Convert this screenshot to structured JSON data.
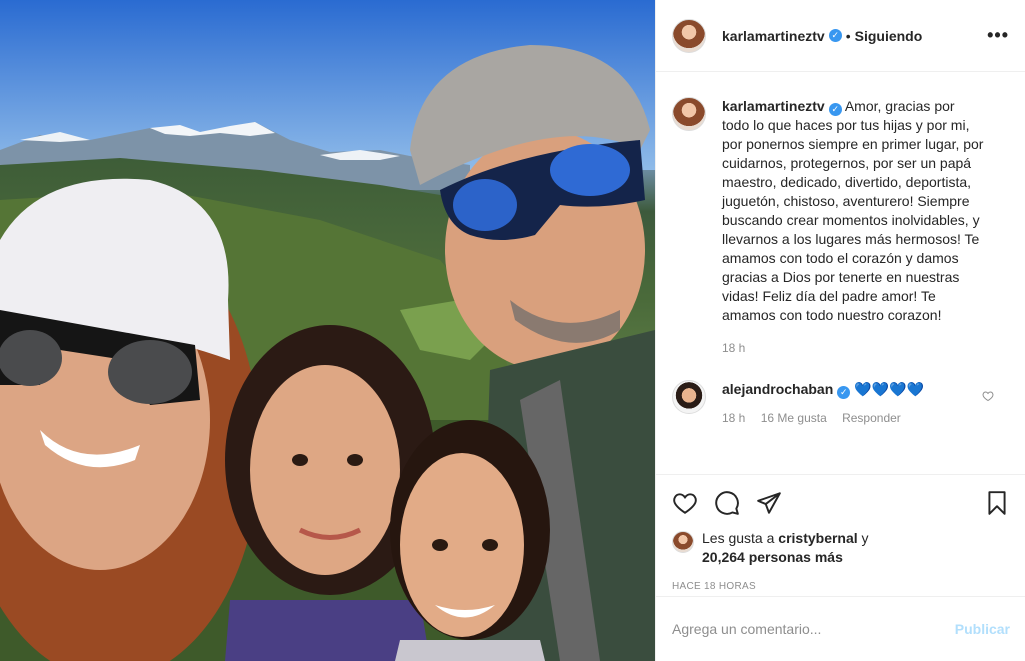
{
  "post_image": {
    "alt_hint": ""
  },
  "header": {
    "username": "karlamartineztv",
    "separator": "•",
    "follow_label": "Siguiendo",
    "more_label": "•••"
  },
  "caption": {
    "username": "karlamartineztv",
    "text": "Amor, gracias por todo lo que haces por tus hijas y por mi, por ponernos siempre en primer lugar, por cuidarnos, protegernos, por ser un papá maestro, dedicado, divertido, deportista, juguetón, chistoso, aventurero! Siempre buscando crear momentos inolvidables, y llevarnos a los lugares más hermosos! Te amamos con todo el corazón y damos gracias a Dios por tenerte en nuestras vidas! Feliz día del padre amor! Te amamos con todo nuestro corazon!",
    "time": "18 h"
  },
  "comments": [
    {
      "username": "alejandrochaban",
      "text": "💙💙💙💙",
      "time": "18 h",
      "likes": "16 Me gusta",
      "reply": "Responder"
    }
  ],
  "likes": {
    "prefix": "Les gusta a",
    "user": "cristybernal",
    "joiner": "y",
    "others": "20,264 personas más"
  },
  "timestamp": "HACE 18 HORAS",
  "add_comment": {
    "placeholder": "Agrega un comentario...",
    "publish_label": "Publicar"
  },
  "colors": {
    "verified": "#3897f0",
    "publish_disabled": "#b2dffc",
    "hearts": "#16b7d6"
  }
}
